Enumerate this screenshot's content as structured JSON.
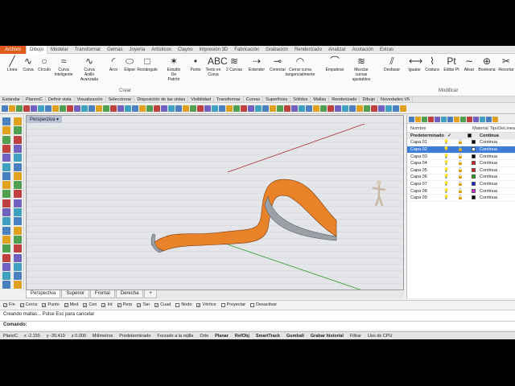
{
  "menubar": [
    "Archivo",
    "Dibujo",
    "Modelar",
    "Transformar",
    "Gemas",
    "Joyería",
    "Artísticos",
    "Clayoo",
    "Impresión 3D",
    "Fabricación",
    "Grabación",
    "Renderizado",
    "Analizar",
    "Acotación",
    "Extras"
  ],
  "ribbon": {
    "buttons": [
      {
        "label": "Línea",
        "icon": "line-icon"
      },
      {
        "label": "Curva",
        "icon": "curve-icon"
      },
      {
        "label": "Círculo",
        "icon": "circle-icon"
      },
      {
        "label": "Curva Inteligente",
        "icon": "smart-curve-icon"
      },
      {
        "label": "Curva Anillo Avanzada",
        "icon": "ring-curve-icon"
      },
      {
        "label": "Arco",
        "icon": "arc-icon"
      },
      {
        "label": "Elipse",
        "icon": "ellipse-icon"
      },
      {
        "label": "Rectángulo",
        "icon": "rectangle-icon"
      },
      {
        "label": "Estudio De Patrón",
        "icon": "pattern-icon"
      },
      {
        "label": "Punto",
        "icon": "point-icon"
      },
      {
        "label": "Texto en Curva",
        "icon": "text-curve-icon"
      },
      {
        "label": "2 Curvas",
        "icon": "two-curves-icon"
      },
      {
        "label": "Extender",
        "icon": "extend-icon"
      },
      {
        "label": "Conectar",
        "icon": "connect-icon"
      },
      {
        "label": "Cerrar curva tangencialmente",
        "icon": "close-curve-icon"
      },
      {
        "label": "Empalmar",
        "icon": "fillet-icon"
      },
      {
        "label": "Mezclar curvas ajustables",
        "icon": "blend-icon"
      },
      {
        "label": "Desfasar",
        "icon": "offset-icon"
      },
      {
        "label": "Igualar",
        "icon": "match-icon"
      },
      {
        "label": "Costura",
        "icon": "seam-icon"
      },
      {
        "label": "Editar Pt",
        "icon": "edit-points-icon"
      },
      {
        "label": "Alisar",
        "icon": "smooth-icon"
      },
      {
        "label": "Booleana",
        "icon": "boolean-icon"
      },
      {
        "label": "Recortar",
        "icon": "trim-icon"
      }
    ],
    "group_crear": "Crear",
    "group_modificar": "Modificar"
  },
  "tabs": [
    "Estándar",
    "PlanosC",
    "Definir vista",
    "Visualización",
    "Seleccionar",
    "Disposición de las vistas",
    "Visibilidad",
    "Transformar",
    "Curvas",
    "Superficies",
    "Sólidos",
    "Mallas",
    "Renderizado",
    "Dibujo",
    "Novedades V6"
  ],
  "viewport": {
    "title": "Perspectiva ▾"
  },
  "viewport_tabs": [
    "Perspectiva",
    "Superior",
    "Frontal",
    "Derecha",
    "+"
  ],
  "layers": {
    "headers": {
      "name": "Nombre",
      "material": "Material",
      "linetype": "TipoDeLínea"
    },
    "rows": [
      {
        "name": "Predeterminado",
        "color": "#000000",
        "type": "Continua",
        "check": "✓"
      },
      {
        "name": "Capa 01",
        "color": "#000000",
        "type": "Continua"
      },
      {
        "name": "Capa 02",
        "color": "#ffffff",
        "type": "Continua"
      },
      {
        "name": "Capa 03",
        "color": "#000000",
        "type": "Continua"
      },
      {
        "name": "Capa 04",
        "color": "#e02020",
        "type": "Continua"
      },
      {
        "name": "Capa 05",
        "color": "#e02020",
        "type": "Continua"
      },
      {
        "name": "Capa 06",
        "color": "#20b020",
        "type": "Continua"
      },
      {
        "name": "Capa 07",
        "color": "#2020e0",
        "type": "Continua"
      },
      {
        "name": "Capa 08",
        "color": "#e020e0",
        "type": "Continua"
      },
      {
        "name": "Capa 09",
        "color": "#000000",
        "type": "Continua"
      }
    ]
  },
  "osnaps": [
    {
      "label": "Fin",
      "checked": true
    },
    {
      "label": "Cerca",
      "checked": true
    },
    {
      "label": "Punto",
      "checked": true
    },
    {
      "label": "Med",
      "checked": true
    },
    {
      "label": "Cen",
      "checked": true
    },
    {
      "label": "Int",
      "checked": true
    },
    {
      "label": "Perp",
      "checked": true
    },
    {
      "label": "Tan",
      "checked": true
    },
    {
      "label": "Cuad",
      "checked": true
    },
    {
      "label": "Nodo",
      "checked": false
    },
    {
      "label": "Vértice",
      "checked": true
    },
    {
      "label": "Proyectar",
      "checked": false
    },
    {
      "label": "Desactivar",
      "checked": false
    }
  ],
  "history": "Creando mallas... Pulse Esc para cancelar",
  "command_label": "Comando:",
  "status": [
    "PlanoC",
    "x -2.155",
    "y -35.419",
    "z 0.000",
    "Milímetros",
    "Predeterminado",
    "Forzado a la rejilla",
    "Orto",
    "Planar",
    "RefObj",
    "SmartTrack",
    "Gumball",
    "Grabar historial",
    "Filtrar",
    "Uso de CPU"
  ],
  "colors": {
    "accent": "#e05a1a",
    "selection": "#3d7dd8",
    "surface": "#e8832a"
  }
}
